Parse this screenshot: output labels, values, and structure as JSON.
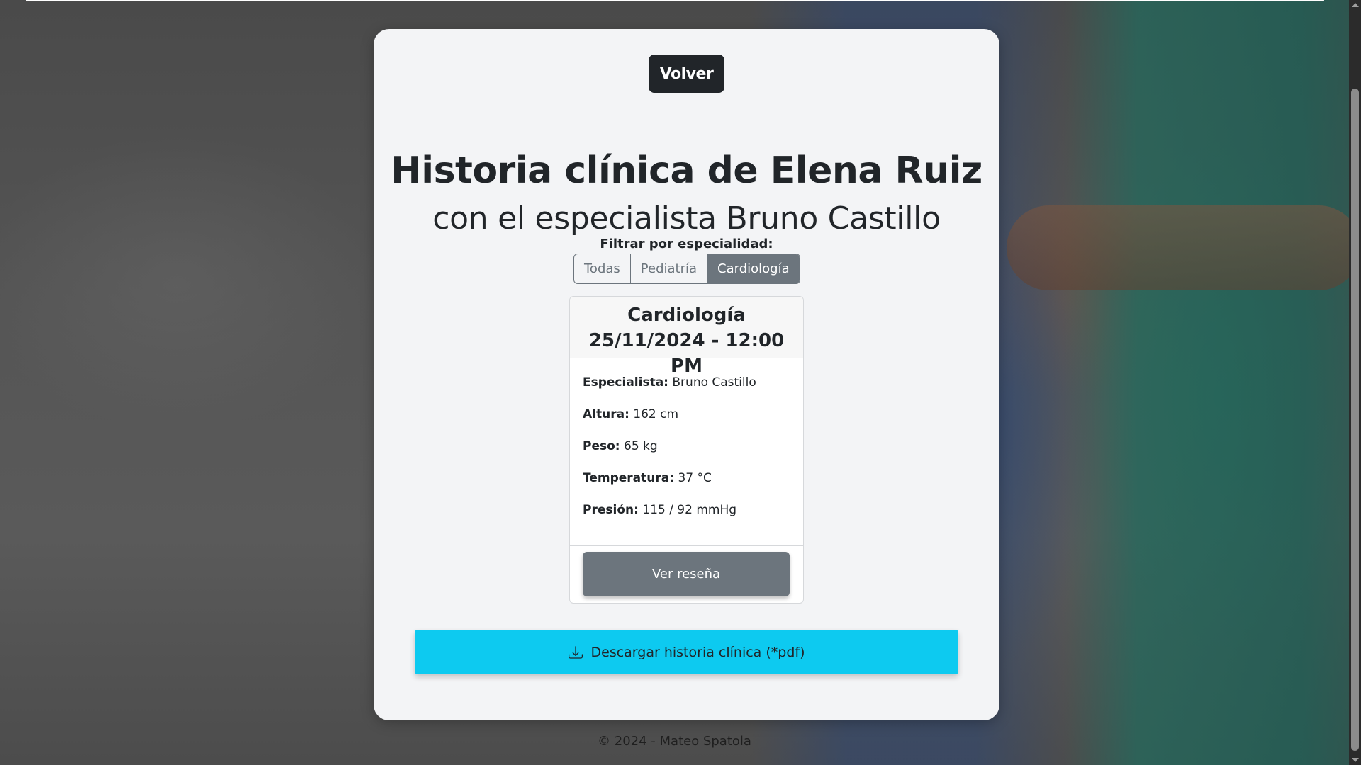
{
  "header": {
    "back_label": "Volver"
  },
  "page": {
    "title": "Historia clínica de Elena Ruiz",
    "subtitle": "con el especialista Bruno Castillo"
  },
  "filter": {
    "label": "Filtrar por especialidad:",
    "options": [
      "Todas",
      "Pediatría",
      "Cardiología"
    ],
    "selected": "Cardiología"
  },
  "record": {
    "specialty": "Cardiología",
    "datetime": "25/11/2024 - 12:00 PM",
    "fields": [
      {
        "label": "Especialista:",
        "value": "Bruno Castillo"
      },
      {
        "label": "Altura:",
        "value": "162 cm"
      },
      {
        "label": "Peso:",
        "value": "65 kg"
      },
      {
        "label": "Temperatura:",
        "value": "37 °C"
      },
      {
        "label": "Presión:",
        "value": "115 / 92 mmHg"
      }
    ],
    "review_button": "Ver reseña"
  },
  "download": {
    "label": "Descargar historia clínica (*pdf)",
    "icon": "download-icon",
    "color": "#0dcaf0"
  },
  "footer": {
    "text": "© 2024 - Mateo Spatola"
  }
}
